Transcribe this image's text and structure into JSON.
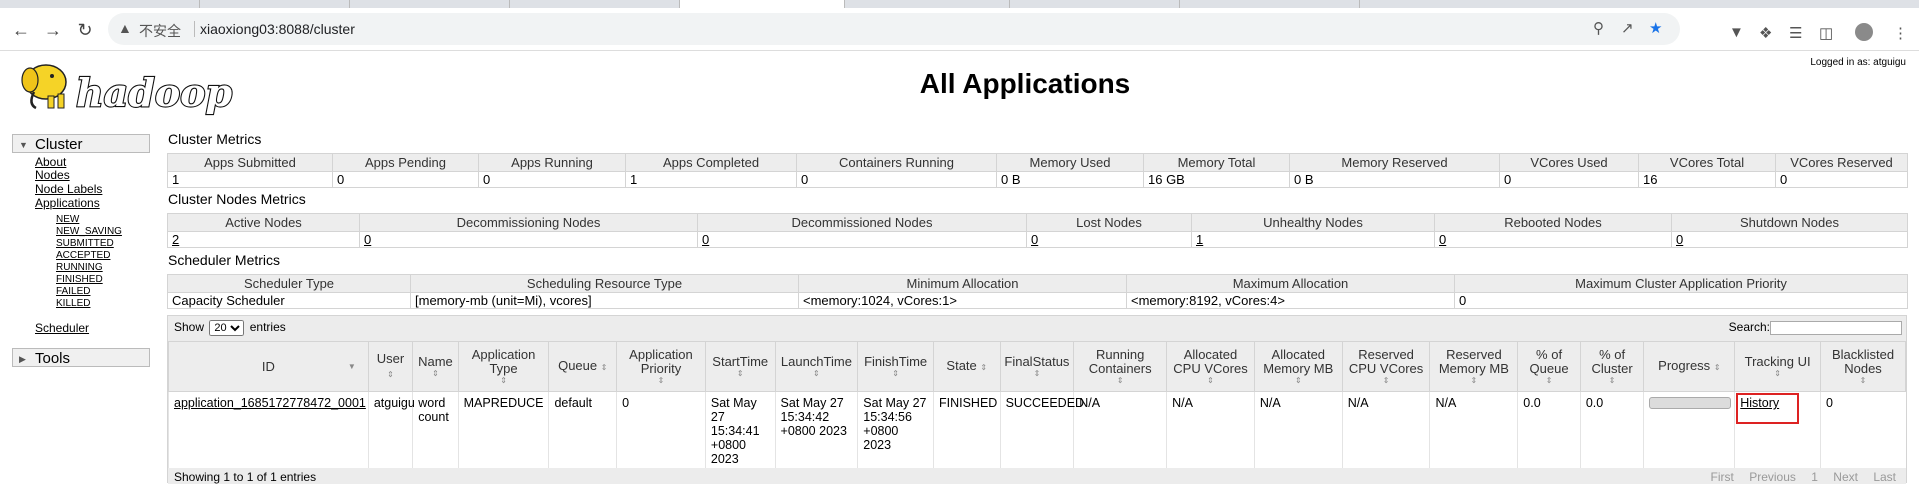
{
  "browser": {
    "security_label": "不安全",
    "url": "xiaoxiong03:8088/cluster"
  },
  "page": {
    "title": "All Applications",
    "logged_in": "Logged in as: atguigu",
    "logo_text": "hadoop"
  },
  "sidebar": {
    "cluster_label": "Cluster",
    "links": {
      "about": "About",
      "nodes": "Nodes",
      "node_labels": "Node Labels",
      "applications": "Applications",
      "scheduler": "Scheduler"
    },
    "app_states": [
      "NEW",
      "NEW_SAVING",
      "SUBMITTED",
      "ACCEPTED",
      "RUNNING",
      "FINISHED",
      "FAILED",
      "KILLED"
    ],
    "tools_label": "Tools"
  },
  "cluster_metrics": {
    "title": "Cluster Metrics",
    "headers": [
      "Apps Submitted",
      "Apps Pending",
      "Apps Running",
      "Apps Completed",
      "Containers Running",
      "Memory Used",
      "Memory Total",
      "Memory Reserved",
      "VCores Used",
      "VCores Total",
      "VCores Reserved"
    ],
    "values": [
      "1",
      "0",
      "0",
      "1",
      "0",
      "0 B",
      "16 GB",
      "0 B",
      "0",
      "16",
      "0"
    ]
  },
  "node_metrics": {
    "title": "Cluster Nodes Metrics",
    "headers": [
      "Active Nodes",
      "Decommissioning Nodes",
      "Decommissioned Nodes",
      "Lost Nodes",
      "Unhealthy Nodes",
      "Rebooted Nodes",
      "Shutdown Nodes"
    ],
    "values": [
      "2",
      "0",
      "0",
      "0",
      "1",
      "0",
      "0"
    ]
  },
  "scheduler_metrics": {
    "title": "Scheduler Metrics",
    "headers": [
      "Scheduler Type",
      "Scheduling Resource Type",
      "Minimum Allocation",
      "Maximum Allocation",
      "Maximum Cluster Application Priority"
    ],
    "values": [
      "Capacity Scheduler",
      "[memory-mb (unit=Mi), vcores]",
      "<memory:1024, vCores:1>",
      "<memory:8192, vCores:4>",
      "0"
    ]
  },
  "apps_table": {
    "show_label": "Show",
    "page_size": "20",
    "entries_label": "entries",
    "search_label": "Search:",
    "headers": [
      "ID",
      "User",
      "Name",
      "Application Type",
      "Queue",
      "Application Priority",
      "StartTime",
      "LaunchTime",
      "FinishTime",
      "State",
      "FinalStatus",
      "Running Containers",
      "Allocated CPU VCores",
      "Allocated Memory MB",
      "Reserved CPU VCores",
      "Reserved Memory MB",
      "% of Queue",
      "% of Cluster",
      "Progress",
      "Tracking UI",
      "Blacklisted Nodes"
    ],
    "row": {
      "id": "application_1685172778472_0001",
      "user": "atguigu",
      "name": "word count",
      "type": "MAPREDUCE",
      "queue": "default",
      "priority": "0",
      "start": "Sat May 27 15:34:41 +0800 2023",
      "launch": "Sat May 27 15:34:42 +0800 2023",
      "finish": "Sat May 27 15:34:56 +0800 2023",
      "state": "FINISHED",
      "final_status": "SUCCEEDED",
      "running_containers": "N/A",
      "alloc_vcores": "N/A",
      "alloc_mem": "N/A",
      "reserved_vcores": "N/A",
      "reserved_mem": "N/A",
      "pct_queue": "0.0",
      "pct_cluster": "0.0",
      "progress": 1.0,
      "tracking_ui": "History",
      "blacklisted": "0"
    },
    "footer_info": "Showing 1 to 1 of 1 entries",
    "pager": [
      "First",
      "Previous",
      "1",
      "Next",
      "Last"
    ]
  }
}
